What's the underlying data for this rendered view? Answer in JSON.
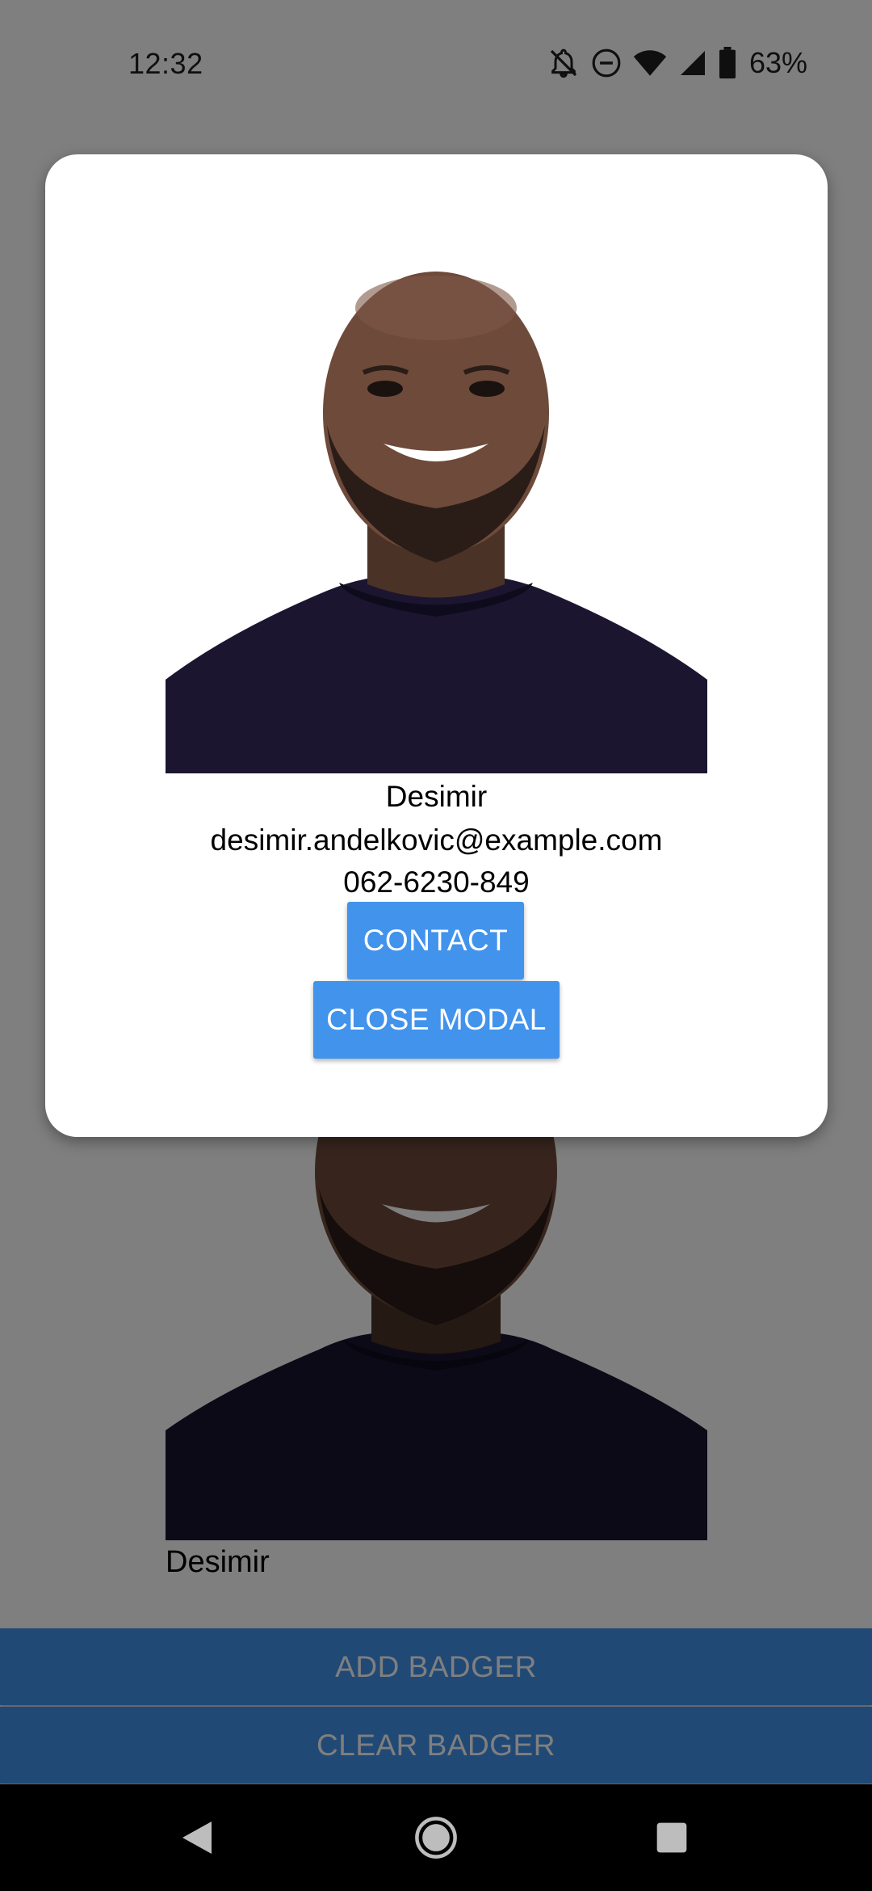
{
  "status_bar": {
    "time": "12:32",
    "battery_percent": "63%",
    "icons": [
      "notifications-off-icon",
      "do-not-disturb-icon",
      "wifi-icon",
      "cell-signal-icon",
      "battery-icon"
    ]
  },
  "modal": {
    "name": "Desimir",
    "email": "desimir.andelkovic@example.com",
    "phone": "062-6230-849",
    "contact_label": "CONTACT",
    "close_label": "CLOSE MODAL"
  },
  "badge": {
    "name": "Desimir"
  },
  "actions": {
    "add_label": "ADD BADGER",
    "clear_label": "CLEAR BADGER"
  },
  "nav": {
    "icons": [
      "back-icon",
      "home-icon",
      "recents-icon"
    ]
  },
  "colors": {
    "accent": "#4293ec",
    "scrim": "#808080",
    "nav_bar": "#000000"
  }
}
